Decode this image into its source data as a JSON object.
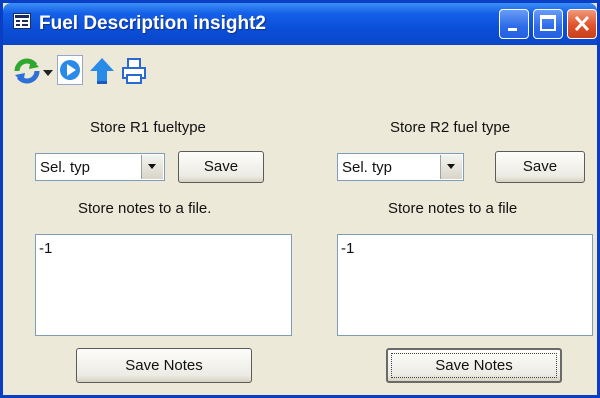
{
  "window": {
    "title": "Fuel Description insight2",
    "controls": [
      "minimize-icon",
      "maximize-icon",
      "close-icon"
    ]
  },
  "toolbar": {
    "icons": [
      "refresh-icon",
      "dropdown-arrow-icon",
      "play-icon",
      "upload-icon",
      "print-icon"
    ]
  },
  "left_panel": {
    "heading": "Store R1 fueltype",
    "select_value": "Sel. typ",
    "save_label": "Save",
    "notes_heading": "Store notes to a file.",
    "notes_value": "-1",
    "save_notes_label": "Save Notes"
  },
  "right_panel": {
    "heading": "Store R2 fuel type",
    "select_value": "Sel. typ",
    "save_label": "Save",
    "notes_heading": "Store notes to a file",
    "notes_value": "-1",
    "save_notes_label": "Save Notes"
  },
  "colors": {
    "titlebar": "#0b4fd8",
    "window_bg": "#ece9d8",
    "close_button": "#e0532c"
  }
}
